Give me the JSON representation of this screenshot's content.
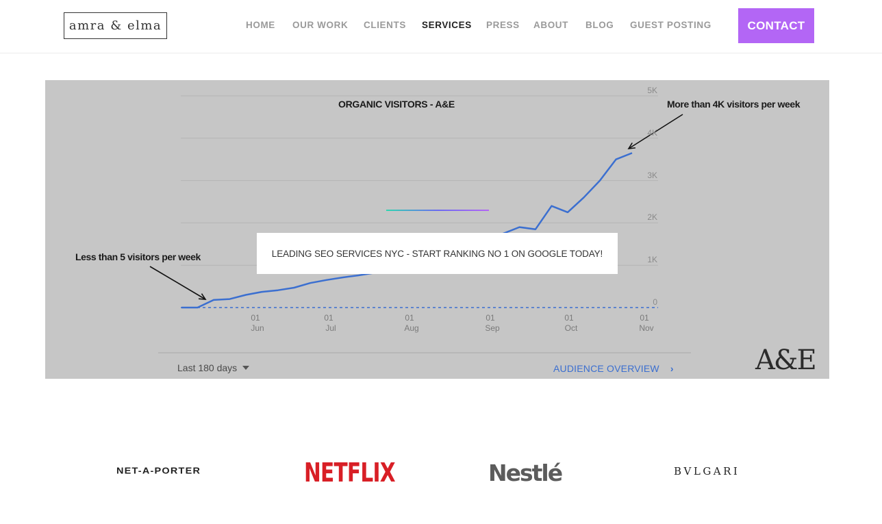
{
  "header": {
    "logo_text": "amra & elma",
    "nav": [
      {
        "label": "HOME",
        "active": false
      },
      {
        "label": "OUR WORK",
        "active": false
      },
      {
        "label": "CLIENTS",
        "active": false
      },
      {
        "label": "SERVICES",
        "active": true
      },
      {
        "label": "PRESS",
        "active": false
      },
      {
        "label": "ABOUT",
        "active": false
      },
      {
        "label": "BLOG",
        "active": false
      },
      {
        "label": "GUEST POSTING",
        "active": false
      }
    ],
    "contact_label": "CONTACT",
    "accent_color": "#b366f5"
  },
  "hero": {
    "overlay_text": "LEADING SEO SERVICES NYC - START RANKING NO 1 ON GOOGLE TODAY!",
    "annotation_high": "More than 4K visitors per week",
    "annotation_low": "Less than 5 visitors per week",
    "range_label": "Last 180 days",
    "audience_link": "AUDIENCE OVERVIEW",
    "brand_mark": "A&E"
  },
  "chart_data": {
    "type": "line",
    "title": "ORGANIC VISITORS - A&E",
    "y_ticks": [
      "5K",
      "4K",
      "3K",
      "2K",
      "1K",
      "0"
    ],
    "x_ticks": [
      {
        "day": "01",
        "month": "Jun"
      },
      {
        "day": "01",
        "month": "Jul"
      },
      {
        "day": "01",
        "month": "Aug"
      },
      {
        "day": "01",
        "month": "Sep"
      },
      {
        "day": "01",
        "month": "Oct"
      },
      {
        "day": "01",
        "month": "Nov"
      }
    ],
    "ylim": [
      0,
      5000
    ],
    "series": [
      {
        "color": "#3b6fd0",
        "values": [
          0,
          0,
          180,
          200,
          300,
          370,
          410,
          470,
          580,
          650,
          710,
          760,
          820,
          900,
          980,
          1050,
          1150,
          1250,
          1400,
          1600,
          1750,
          1900,
          1850,
          2400,
          2250,
          2600,
          3000,
          3500,
          3650
        ]
      }
    ],
    "grid": true,
    "legend": "none"
  },
  "clients": [
    "NET-A-PORTER",
    "NETFLIX",
    "Nestlé",
    "BVLGARI"
  ]
}
